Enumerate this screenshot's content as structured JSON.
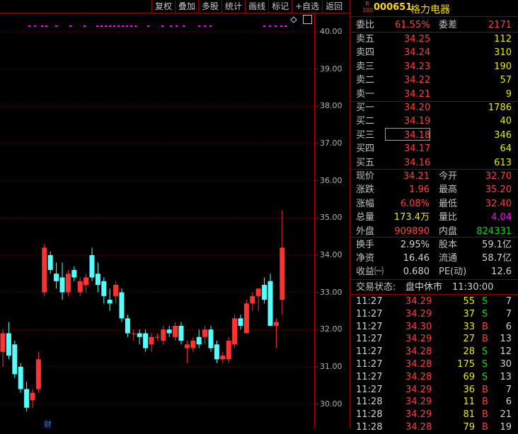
{
  "toolbar": [
    "复权",
    "叠加",
    "多股",
    "统计",
    "画线",
    "标记",
    "+自选",
    "返回"
  ],
  "chart_data": {
    "type": "candlestick",
    "yticks": [
      "40.00",
      "39.00",
      "38.00",
      "37.00",
      "36.00",
      "35.00",
      "34.00",
      "33.00",
      "32.00",
      "31.00",
      "30.00"
    ],
    "ylim": [
      29.8,
      40.3
    ],
    "colors": {
      "up": "#ff3232",
      "down": "#54ffff"
    },
    "candles": [
      {
        "o": 31.4,
        "h": 32.0,
        "l": 31.0,
        "c": 31.9
      },
      {
        "o": 31.9,
        "h": 32.2,
        "l": 31.2,
        "c": 31.3
      },
      {
        "o": 31.6,
        "h": 31.7,
        "l": 30.7,
        "c": 30.8
      },
      {
        "o": 31.0,
        "h": 31.1,
        "l": 30.3,
        "c": 30.4
      },
      {
        "o": 30.4,
        "h": 30.6,
        "l": 29.8,
        "c": 29.9
      },
      {
        "o": 30.1,
        "h": 30.4,
        "l": 29.9,
        "c": 30.3
      },
      {
        "o": 30.4,
        "h": 31.4,
        "l": 30.3,
        "c": 31.2
      },
      {
        "o": 33.0,
        "h": 34.3,
        "l": 32.9,
        "c": 34.2
      },
      {
        "o": 34.0,
        "h": 34.1,
        "l": 33.5,
        "c": 33.6
      },
      {
        "o": 33.5,
        "h": 33.8,
        "l": 33.1,
        "c": 33.3
      },
      {
        "o": 33.4,
        "h": 33.8,
        "l": 32.8,
        "c": 33.0
      },
      {
        "o": 33.0,
        "h": 33.6,
        "l": 32.9,
        "c": 33.5
      },
      {
        "o": 33.6,
        "h": 33.7,
        "l": 33.3,
        "c": 33.4
      },
      {
        "o": 33.0,
        "h": 33.4,
        "l": 32.9,
        "c": 33.3
      },
      {
        "o": 33.2,
        "h": 33.5,
        "l": 33.0,
        "c": 33.4
      },
      {
        "o": 34.0,
        "h": 34.2,
        "l": 33.3,
        "c": 33.4
      },
      {
        "o": 33.5,
        "h": 33.8,
        "l": 33.0,
        "c": 33.2
      },
      {
        "o": 33.3,
        "h": 33.4,
        "l": 32.7,
        "c": 32.9
      },
      {
        "o": 32.8,
        "h": 33.1,
        "l": 32.5,
        "c": 32.7
      },
      {
        "o": 32.9,
        "h": 33.3,
        "l": 32.7,
        "c": 33.2
      },
      {
        "o": 33.0,
        "h": 33.1,
        "l": 32.2,
        "c": 32.3
      },
      {
        "o": 32.3,
        "h": 32.4,
        "l": 31.8,
        "c": 31.9
      },
      {
        "o": 31.9,
        "h": 32.0,
        "l": 31.7,
        "c": 31.9
      },
      {
        "o": 31.9,
        "h": 32.0,
        "l": 31.6,
        "c": 31.8
      },
      {
        "o": 31.9,
        "h": 32.0,
        "l": 31.4,
        "c": 31.5
      },
      {
        "o": 31.6,
        "h": 31.9,
        "l": 31.4,
        "c": 31.8
      },
      {
        "o": 31.8,
        "h": 31.9,
        "l": 31.7,
        "c": 31.8
      },
      {
        "o": 31.7,
        "h": 32.1,
        "l": 31.6,
        "c": 32.0
      },
      {
        "o": 32.0,
        "h": 32.1,
        "l": 31.8,
        "c": 31.9
      },
      {
        "o": 31.8,
        "h": 32.2,
        "l": 31.7,
        "c": 32.1
      },
      {
        "o": 32.1,
        "h": 32.2,
        "l": 31.6,
        "c": 31.7
      },
      {
        "o": 31.5,
        "h": 31.7,
        "l": 31.1,
        "c": 31.6
      },
      {
        "o": 31.5,
        "h": 31.8,
        "l": 31.4,
        "c": 31.7
      },
      {
        "o": 31.8,
        "h": 32.0,
        "l": 31.5,
        "c": 31.6
      },
      {
        "o": 31.8,
        "h": 32.1,
        "l": 31.6,
        "c": 32.0
      },
      {
        "o": 32.0,
        "h": 32.1,
        "l": 31.4,
        "c": 31.5
      },
      {
        "o": 31.6,
        "h": 31.7,
        "l": 31.1,
        "c": 31.2
      },
      {
        "o": 31.2,
        "h": 31.4,
        "l": 31.1,
        "c": 31.3
      },
      {
        "o": 31.2,
        "h": 31.8,
        "l": 31.1,
        "c": 31.7
      },
      {
        "o": 31.6,
        "h": 32.4,
        "l": 31.5,
        "c": 32.3
      },
      {
        "o": 32.3,
        "h": 32.4,
        "l": 32.0,
        "c": 32.1
      },
      {
        "o": 31.9,
        "h": 32.8,
        "l": 31.9,
        "c": 32.7
      },
      {
        "o": 32.7,
        "h": 33.0,
        "l": 32.5,
        "c": 32.9
      },
      {
        "o": 32.9,
        "h": 33.1,
        "l": 32.5,
        "c": 33.1
      },
      {
        "o": 33.2,
        "h": 33.4,
        "l": 32.7,
        "c": 32.8
      },
      {
        "o": 33.3,
        "h": 33.5,
        "l": 32.1,
        "c": 32.1
      },
      {
        "o": 32.1,
        "h": 32.3,
        "l": 31.5,
        "c": 32.2
      },
      {
        "o": 32.8,
        "h": 35.2,
        "l": 32.4,
        "c": 34.2
      }
    ],
    "markers": [
      "财"
    ]
  },
  "quote": {
    "badge_top": "R",
    "badge_bottom": "300",
    "code": "000651",
    "name": "格力电器",
    "wei_bi_label": "委比",
    "wei_bi": "61.55%",
    "wei_cha_label": "委差",
    "wei_cha": "2171",
    "asks": [
      {
        "label": "卖五",
        "price": "34.25",
        "vol": "112"
      },
      {
        "label": "卖四",
        "price": "34.24",
        "vol": "310"
      },
      {
        "label": "卖三",
        "price": "34.23",
        "vol": "190"
      },
      {
        "label": "卖二",
        "price": "34.22",
        "vol": "57"
      },
      {
        "label": "卖一",
        "price": "34.21",
        "vol": "9"
      }
    ],
    "bids": [
      {
        "label": "买一",
        "price": "34.20",
        "vol": "1786"
      },
      {
        "label": "买二",
        "price": "34.19",
        "vol": "40"
      },
      {
        "label": "买三",
        "price": "34.18",
        "vol": "346"
      },
      {
        "label": "买四",
        "price": "34.17",
        "vol": "64"
      },
      {
        "label": "买五",
        "price": "34.16",
        "vol": "613"
      }
    ],
    "stats": [
      {
        "l1": "现价",
        "v1": "34.21",
        "c1": "red",
        "l2": "今开",
        "v2": "32.70",
        "c2": "red"
      },
      {
        "l1": "涨跌",
        "v1": "1.96",
        "c1": "red",
        "l2": "最高",
        "v2": "35.20",
        "c2": "red"
      },
      {
        "l1": "涨幅",
        "v1": "6.08%",
        "c1": "red",
        "l2": "最低",
        "v2": "32.40",
        "c2": "red"
      },
      {
        "l1": "总量",
        "v1": "173.4万",
        "c1": "yel",
        "l2": "量比",
        "v2": "4.04",
        "c2": "mag"
      },
      {
        "l1": "外盘",
        "v1": "909890",
        "c1": "red",
        "l2": "内盘",
        "v2": "824331",
        "c2": "grn"
      }
    ],
    "stats2": [
      {
        "l1": "换手",
        "v1": "2.95%",
        "l2": "股本",
        "v2": "59.1亿"
      },
      {
        "l1": "净资",
        "v1": "16.46",
        "l2": "流通",
        "v2": "58.7亿"
      },
      {
        "l1": "收益㈠",
        "v1": "0.680",
        "l2": "PE(动)",
        "v2": "12.6"
      }
    ],
    "status_label": "交易状态:",
    "status": "盘中休市",
    "status_time": "11:30:00",
    "ticks": [
      {
        "t": "11:27",
        "p": "34.29",
        "v": "55",
        "s": "S",
        "n": "7"
      },
      {
        "t": "11:27",
        "p": "34.29",
        "v": "37",
        "s": "S",
        "n": "7"
      },
      {
        "t": "11:27",
        "p": "34.30",
        "v": "33",
        "s": "B",
        "n": "6"
      },
      {
        "t": "11:27",
        "p": "34.29",
        "v": "27",
        "s": "B",
        "n": "13"
      },
      {
        "t": "11:27",
        "p": "34.28",
        "v": "28",
        "s": "S",
        "n": "12"
      },
      {
        "t": "11:27",
        "p": "34.28",
        "v": "175",
        "s": "S",
        "n": "30"
      },
      {
        "t": "11:27",
        "p": "34.28",
        "v": "69",
        "s": "S",
        "n": "13"
      },
      {
        "t": "11:27",
        "p": "34.29",
        "v": "36",
        "s": "B",
        "n": "7"
      },
      {
        "t": "11:28",
        "p": "34.29",
        "v": "11",
        "s": "B",
        "n": "6"
      },
      {
        "t": "11:28",
        "p": "34.29",
        "v": "81",
        "s": "B",
        "n": "21"
      },
      {
        "t": "11:28",
        "p": "34.28",
        "v": "79",
        "s": "B",
        "n": "19"
      }
    ]
  }
}
